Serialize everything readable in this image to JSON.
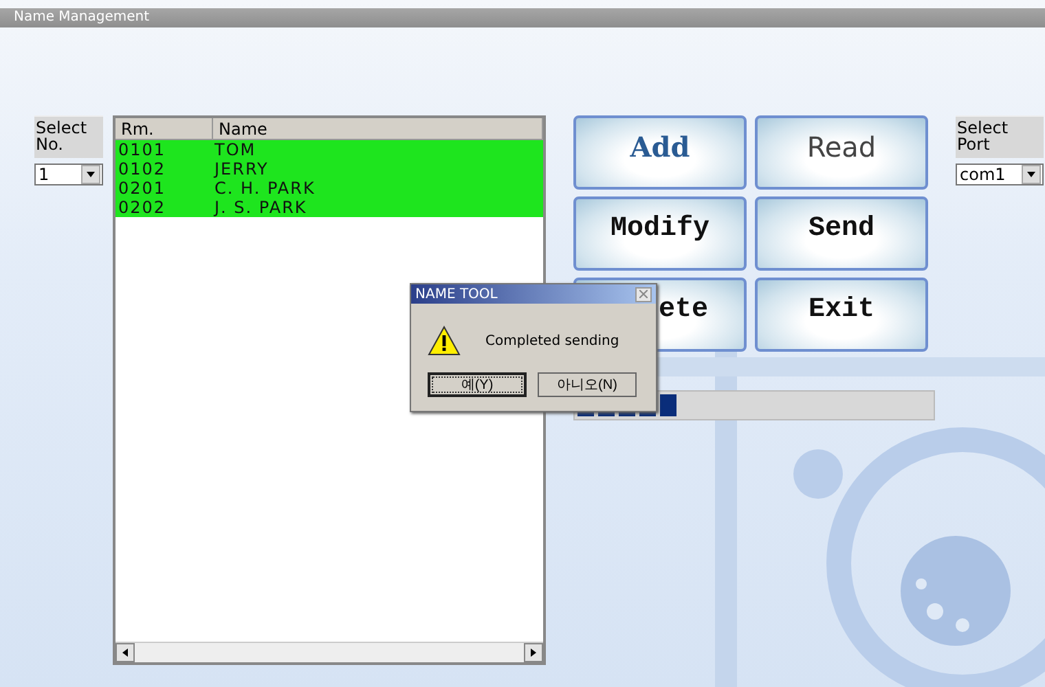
{
  "window": {
    "title": "Name Management"
  },
  "select_no": {
    "label": "Select No.",
    "value": "1"
  },
  "list": {
    "columns": [
      "Rm.",
      "Name"
    ],
    "rows": [
      {
        "room": "0101",
        "name": "TOM",
        "selected": true
      },
      {
        "room": "0102",
        "name": "JERRY",
        "selected": true
      },
      {
        "room": "0201",
        "name": "C. H. PARK",
        "selected": true
      },
      {
        "room": "0202",
        "name": "J. S. PARK",
        "selected": true
      }
    ]
  },
  "buttons": [
    {
      "label": "Add",
      "kind": "serif"
    },
    {
      "label": "Read",
      "kind": "sans"
    },
    {
      "label": "Modify",
      "kind": "mono"
    },
    {
      "label": "Send",
      "kind": "mono"
    },
    {
      "label": "ete",
      "kind": "mono",
      "covered": true
    },
    {
      "label": "Exit",
      "kind": "mono"
    }
  ],
  "select_port": {
    "label": "Select Port",
    "value": "com1"
  },
  "progress": {
    "level": 0.29
  },
  "dialog": {
    "title": "NAME TOOL",
    "message": "Completed sending",
    "buttons": [
      {
        "label": "예(Y)",
        "selected": true
      },
      {
        "label": "아니오(N)",
        "selected": false
      }
    ]
  }
}
